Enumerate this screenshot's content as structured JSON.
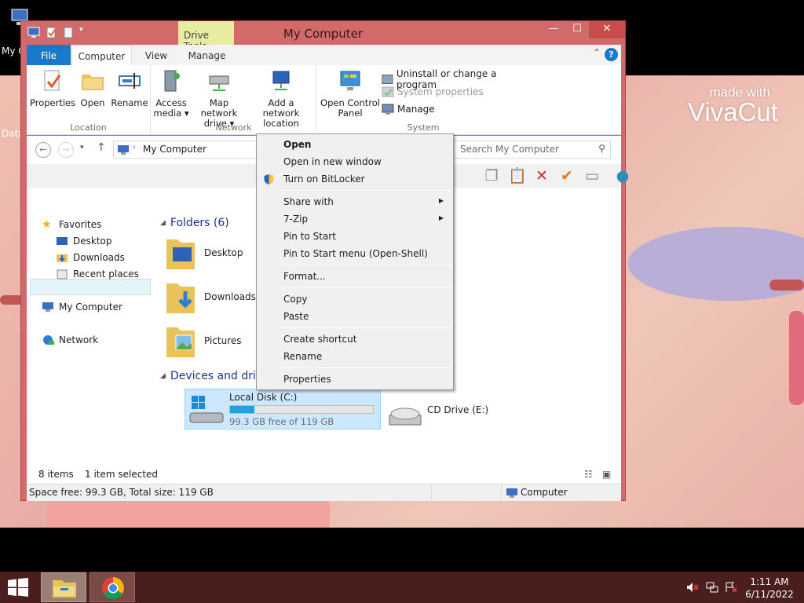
{
  "desktop": {
    "watermark_small": "made with",
    "watermark_big": "VivaCut",
    "icon_label_partial_1": "My C",
    "icon_label_partial_2": "Data"
  },
  "window": {
    "title": "My Computer",
    "drive_tools": "Drive Tools",
    "controls": {
      "minimize": "—",
      "maximize": "☐",
      "close": "✕"
    }
  },
  "ribbon": {
    "tabs": [
      "File",
      "Computer",
      "View",
      "Manage"
    ],
    "groups": {
      "location": {
        "label": "Location",
        "buttons": [
          "Properties",
          "Open",
          "Rename"
        ]
      },
      "network": {
        "label": "Network",
        "access_media": [
          "Access",
          "media ▾"
        ],
        "map_drive": [
          "Map network",
          "drive ▾"
        ],
        "add_location": [
          "Add a network",
          "location"
        ]
      },
      "system": {
        "label": "System",
        "control_panel": [
          "Open Control",
          "Panel"
        ],
        "uninstall": "Uninstall or change a program",
        "system_properties": "System properties",
        "manage": "Manage"
      }
    }
  },
  "nav": {
    "address": "My Computer",
    "search_placeholder": "Search My Computer"
  },
  "navpane": {
    "favorites": "Favorites",
    "desktop": "Desktop",
    "downloads": "Downloads",
    "recent": "Recent places",
    "my_computer": "My Computer",
    "network": "Network"
  },
  "main": {
    "folders_header": "Folders (6)",
    "folders": [
      "Desktop",
      "Downloads",
      "Pictures"
    ],
    "devices_header": "Devices and drives (2)",
    "drive": {
      "name": "Local Disk (C:)",
      "free": "99.3 GB free of 119 GB",
      "used_fraction": 0.17
    },
    "dvd_label": "CD Drive (E:)"
  },
  "status": {
    "items": "8 items",
    "selected": "1 item selected"
  },
  "details": {
    "space": "Space free: 99.3 GB, Total size: 119 GB",
    "location": "Computer"
  },
  "context_menu": {
    "open": "Open",
    "open_new_window": "Open in new window",
    "bitlocker": "Turn on BitLocker",
    "share_with": "Share with",
    "seven_zip": "7-Zip",
    "pin_start": "Pin to Start",
    "pin_start_menu": "Pin to Start menu (Open-Shell)",
    "format": "Format...",
    "copy": "Copy",
    "paste": "Paste",
    "create_shortcut": "Create shortcut",
    "rename": "Rename",
    "properties": "Properties"
  },
  "taskbar": {
    "time": "1:11 AM",
    "date": "6/11/2022"
  },
  "colors": {
    "window_frame": "#d16b6b",
    "accent": "#1979ca",
    "selection": "#cce8ff",
    "taskbar": "#4b1e1e"
  }
}
